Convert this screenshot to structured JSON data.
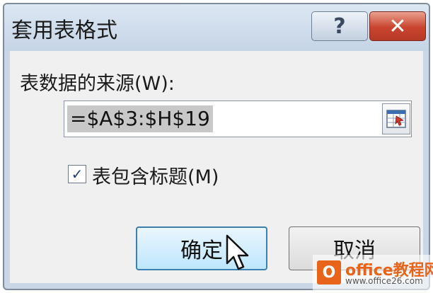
{
  "dialog": {
    "title": "套用表格式",
    "help_label": "?",
    "close_label": "✕"
  },
  "source": {
    "label": "表数据的来源(W):",
    "value": "=$A$3:$H$19"
  },
  "headers_checkbox": {
    "label": "表包含标题(M)",
    "checked": true,
    "mark": "✓"
  },
  "buttons": {
    "ok_label": "确定",
    "cancel_label": "取消"
  },
  "watermark": {
    "logo_text": "O",
    "title": "office教程网",
    "url": "www.office26.com"
  },
  "colors": {
    "title_bar": "#c9d6e6",
    "close_button": "#c9442e",
    "ok_button_border": "#3c7fb1",
    "dialog_body": "#f0f0f0"
  },
  "icons": {
    "range_collapse": "range-select-icon",
    "cursor": "mouse-pointer-icon"
  }
}
